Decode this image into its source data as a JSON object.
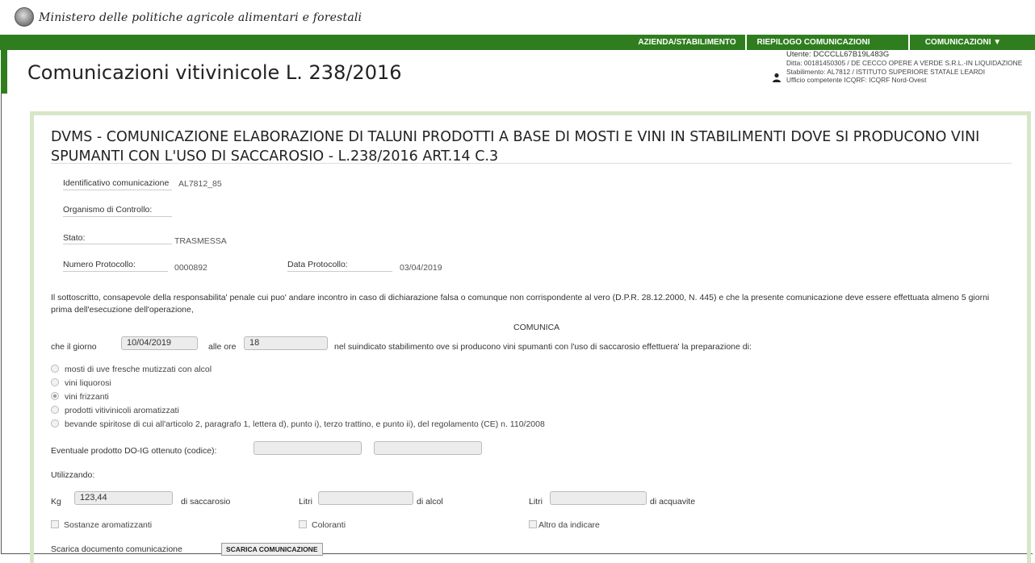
{
  "header": {
    "ministry": "Ministero delle politiche agricole alimentari e forestali",
    "app_title": "Comunicazioni vitivinicole L. 238/2016"
  },
  "nav": {
    "items": [
      "AZIENDA/STABILIMENTO",
      "RIEPILOGO COMUNICAZIONI",
      "COMUNICAZIONI ▼"
    ]
  },
  "user": {
    "utente": "Utente: DCCCLL67B19L483G",
    "ditta": "Ditta: 00181450305 / DE CECCO OPERE A VERDE S.R.L.-IN LIQUIDAZIONE",
    "stabilimento": "Stabilimento: AL7812 / ISTITUTO SUPERIORE STATALE LEARDI",
    "ufficio": "Ufficio competente ICQRF: ICQRF Nord-Ovest"
  },
  "doc": {
    "title": "DVMS - COMUNICAZIONE ELABORAZIONE DI TALUNI PRODOTTI A BASE DI MOSTI E VINI IN STABILIMENTI DOVE SI PRODUCONO VINI SPUMANTI CON L'USO DI SACCAROSIO - L.238/2016 ART.14 C.3",
    "id_label": "Identificativo comunicazione",
    "id_value": "AL7812_85",
    "organismo_label": "Organismo di Controllo:",
    "stato_label": "Stato:",
    "stato_value": "TRASMESSA",
    "protocollo_label": "Numero Protocollo:",
    "protocollo_value": "0000892",
    "data_protocollo_label": "Data Protocollo:",
    "data_protocollo_value": "03/04/2019",
    "paragraph": "Il sottoscritto, consapevole della responsabilita' penale cui puo' andare incontro in caso di dichiarazione falsa o comunque non corrispondente al vero (D.P.R. 28.12.2000, N. 445) e che la presente comunicazione deve essere effettuata almeno 5 giorni prima dell'esecuzione dell'operazione,",
    "comunica": "COMUNICA",
    "giorno_label": "che il giorno",
    "giorno_value": "10/04/2019",
    "ore_label": "alle ore",
    "ore_value": "18",
    "suindicato": "nel suindicato stabilimento ove si producono vini spumanti con l'uso di saccarosio effettuera' la preparazione di:",
    "options": [
      "mosti di uve fresche mutizzati con alcol",
      "vini liquorosi",
      "vini frizzanti",
      "prodotti vitivinicoli aromatizzati",
      "bevande spiritose di cui all'articolo 2, paragrafo 1, lettera d), punto i), terzo trattino, e punto ii), del regolamento (CE) n. 110/2008"
    ],
    "selected_option": 2,
    "doig_label": "Eventuale prodotto DO-IG ottenuto (codice):",
    "utilizzando": "Utilizzando:",
    "kg_label": "Kg",
    "kg_value": "123,44",
    "saccarosio": "di saccarosio",
    "litri_label": "Litri",
    "alcol": "di alcol",
    "acquavite": "di acquavite",
    "chk_sostanze": "Sostanze aromatizzanti",
    "chk_coloranti": "Coloranti",
    "chk_altro": "Altro da indicare",
    "scarica_label": "Scarica documento comunicazione",
    "scarica_button": "SCARICA COMUNICAZIONE"
  },
  "colors": {
    "nav_green": "#2f7d1f",
    "panel_border": "#d8e6c8"
  }
}
